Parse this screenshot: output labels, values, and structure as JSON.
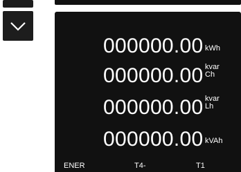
{
  "screen": {
    "readings": [
      {
        "value": "000000.00",
        "unit_line1": "kWh",
        "unit_line2": ""
      },
      {
        "value": "000000.00",
        "unit_line1": "kvar",
        "unit_line2": "Ch"
      },
      {
        "value": "000000.00",
        "unit_line1": "kvar",
        "unit_line2": "Lh"
      },
      {
        "value": "000000.00",
        "unit_line1": "kVAh",
        "unit_line2": ""
      }
    ],
    "footer": {
      "left": "ENER",
      "middle": "T4-",
      "right": "T1"
    }
  },
  "controls": {
    "up_icon": "chevron-up-icon",
    "down_icon": "chevron-down-icon"
  },
  "colors": {
    "display_bg": "#111111",
    "button_bg": "#1d1d1d",
    "text": "#ffffff"
  }
}
